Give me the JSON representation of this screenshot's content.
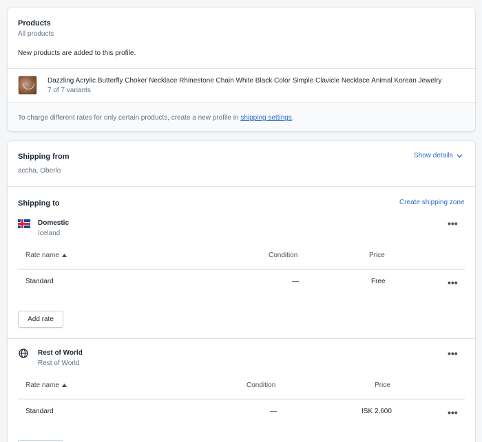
{
  "products": {
    "title": "Products",
    "subtitle": "All products",
    "note": "New products are added to this profile.",
    "item": {
      "name": "Dazzling Acrylic Butterfly Choker Necklace Rhinestone Chain White Black Color Simple Clavicle Necklace Animal Korean Jewelry",
      "variants": "7 of 7 variants"
    },
    "footer_text": "To charge different rates for only certain products, create a new profile in ",
    "footer_link": "shipping settings",
    "footer_end": "."
  },
  "shipping_from": {
    "title": "Shipping from",
    "location": "accha, Oberlo",
    "show_details": "Show details"
  },
  "shipping_to": {
    "title": "Shipping to",
    "create_zone": "Create shipping zone",
    "zones": [
      {
        "name": "Domestic",
        "country": "Iceland",
        "icon": "iceland-flag-icon",
        "headers": {
          "rate_name": "Rate name",
          "condition": "Condition",
          "price": "Price"
        },
        "rates": [
          {
            "name": "Standard",
            "condition": "—",
            "price": "Free"
          }
        ],
        "add_rate": "Add rate"
      },
      {
        "name": "Rest of World",
        "country": "Rest of World",
        "icon": "globe-icon",
        "headers": {
          "rate_name": "Rate name",
          "condition": "Condition",
          "price": "Price"
        },
        "rates": [
          {
            "name": "Standard",
            "condition": "—",
            "price": "ISK 2,600"
          }
        ]
      }
    ]
  },
  "colors": {
    "link": "#2c6ecb",
    "text": "#212b36",
    "muted": "#637381",
    "background": "#f4f6f8"
  }
}
